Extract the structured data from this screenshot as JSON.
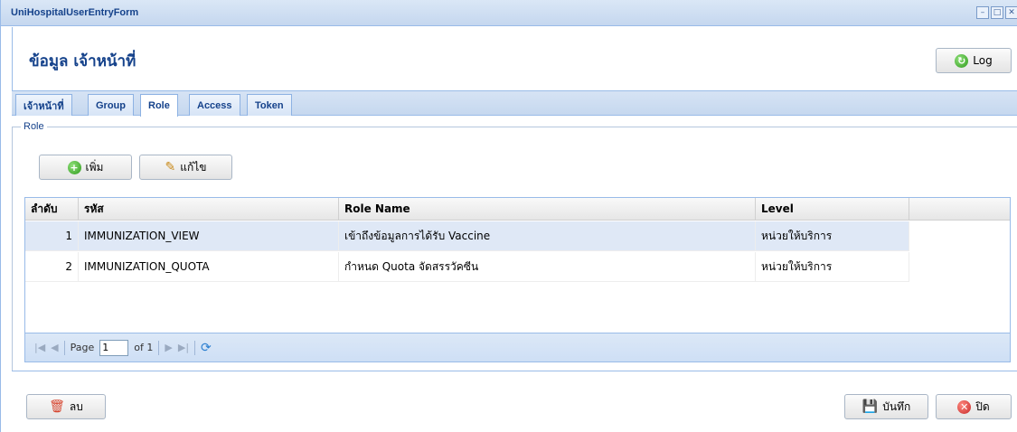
{
  "window": {
    "title": "UniHospitalUserEntryForm",
    "controls": [
      "minimize-icon",
      "maximize-icon",
      "close-icon"
    ]
  },
  "header": {
    "page_title": "ข้อมูล เจ้าหน้าที่",
    "log_button": "Log"
  },
  "tabs": [
    {
      "label": "เจ้าหน้าที่",
      "active": false
    },
    {
      "label": "Group",
      "active": false
    },
    {
      "label": "Role",
      "active": true
    },
    {
      "label": "Access",
      "active": false
    },
    {
      "label": "Token",
      "active": false
    }
  ],
  "fieldset": {
    "legend": "Role"
  },
  "toolbar": {
    "add_label": "เพิ่ม",
    "edit_label": "แก้ไข"
  },
  "grid": {
    "columns": [
      "ลำดับ",
      "รหัส",
      "Role Name",
      "Level"
    ],
    "rows": [
      {
        "no": "1",
        "code": "IMMUNIZATION_VIEW",
        "role_name": "เข้าถึงข้อมูลการได้รับ Vaccine",
        "level": "หน่วยให้บริการ",
        "selected": true
      },
      {
        "no": "2",
        "code": "IMMUNIZATION_QUOTA",
        "role_name": "กำหนด Quota จัดสรรวัคซีน",
        "level": "หน่วยให้บริการ",
        "selected": false
      }
    ]
  },
  "pager": {
    "page_label": "Page",
    "page_value": "1",
    "of_label": "of 1"
  },
  "footer": {
    "delete_label": "ลบ",
    "save_label": "บันทึก",
    "close_label": "ปิด"
  },
  "colors": {
    "title_blue": "#15428b",
    "panel_border": "#99bbe8",
    "selected_row": "#dfe8f6"
  }
}
